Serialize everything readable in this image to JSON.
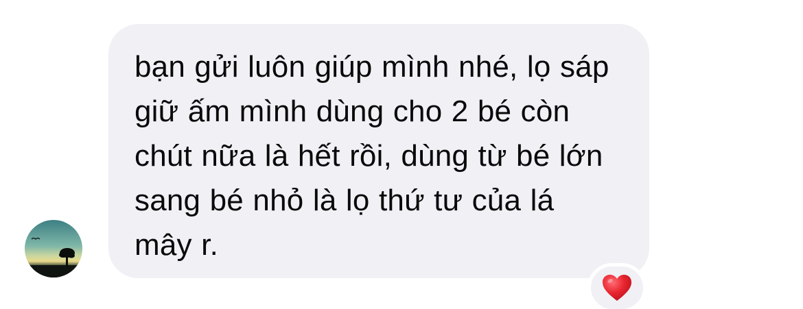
{
  "message": {
    "text": "bạn gửi luôn giúp mình nhé, lọ sáp giữ ấm mình dùng cho 2 bé còn chút nữa là hết rồi, dùng từ bé lớn sang bé nhỏ là lọ thứ tư của lá mây r.",
    "bubble_color": "#f0f0f5",
    "text_color": "#0a0a0a"
  },
  "sender": {
    "avatar_icon": "landscape-silhouette-tree"
  },
  "reaction": {
    "icon": "red-heart-icon",
    "color": "#e0202f"
  }
}
